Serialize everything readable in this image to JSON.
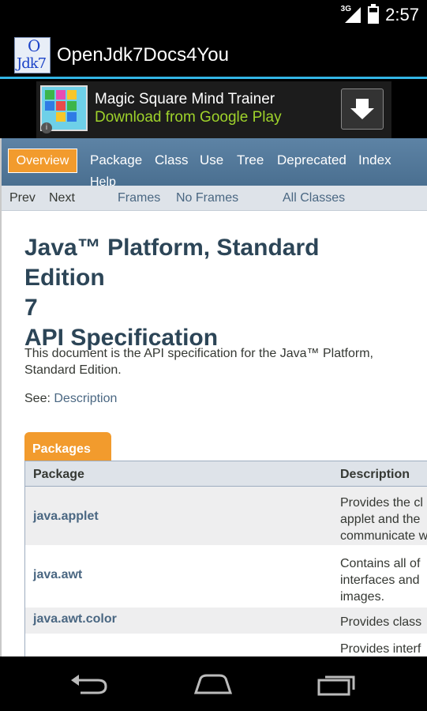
{
  "status_bar": {
    "network": "3G",
    "time": "2:57"
  },
  "app": {
    "title": "OpenJdk7Docs4You",
    "icon_top": "O",
    "icon_bottom": "Jdk7"
  },
  "ad": {
    "title": "Magic Square Mind Trainer",
    "subtitle": "Download from Google Play",
    "info_label": "i"
  },
  "doc": {
    "nav": {
      "active": "Overview",
      "items": [
        "Package",
        "Class",
        "Use",
        "Tree",
        "Deprecated",
        "Index"
      ],
      "help": "Help"
    },
    "subnav": {
      "prev": "Prev",
      "next": "Next",
      "frames": "Frames",
      "no_frames": "No Frames",
      "all_classes": "All Classes"
    },
    "title_line1": "Java™ Platform, Standard Edition",
    "title_line2": "7",
    "title_line3": "API Specification",
    "intro": "This document is the API specification for the Java™ Platform, Standard Edition.",
    "see_label": "See:",
    "see_link": "Description",
    "packages_caption": "Packages",
    "columns": [
      "Package",
      "Description"
    ],
    "rows": [
      {
        "package": "java.applet",
        "description": [
          "Provides the cl",
          "applet and the",
          "communicate w"
        ]
      },
      {
        "package": "java.awt",
        "description": [
          "Contains all of",
          "interfaces and",
          "images."
        ]
      },
      {
        "package": "java.awt.color",
        "description": [
          "Provides class"
        ]
      },
      {
        "package": "",
        "description": [
          "Provides interf"
        ]
      }
    ]
  },
  "colors": {
    "accent": "#33b5e5",
    "nav_bg": "#4a6f90",
    "tab_orange": "#f29b2d",
    "link": "#4a6782",
    "ad_green": "#9fd32b"
  },
  "nav_icons": [
    "back-icon",
    "home-icon",
    "recent-apps-icon"
  ]
}
